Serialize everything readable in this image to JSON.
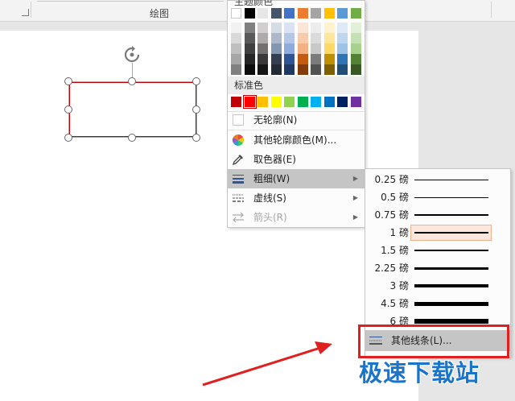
{
  "ribbon": {
    "group_label": "绘图"
  },
  "outline_menu": {
    "theme_colors_title": "主题颜色",
    "standard_colors_label": "标准色",
    "no_outline": "无轮廓(N)",
    "more_outline_colors": "其他轮廓颜色(M)...",
    "eyedropper": "取色器(E)",
    "weight": "粗细(W)",
    "dashes": "虚线(S)",
    "arrows": "箭头(R)",
    "theme_top_colors": [
      "#ffffff",
      "#000000",
      "#e7e6e6",
      "#44546a",
      "#4472c4",
      "#ed7d31",
      "#a5a5a5",
      "#ffc000",
      "#5b9bd5",
      "#70ad47"
    ],
    "standard_colors": [
      "#c00000",
      "#ff0000",
      "#ffc000",
      "#ffff00",
      "#92d050",
      "#00b050",
      "#00b0f0",
      "#0070c0",
      "#002060",
      "#7030a0"
    ],
    "selected_standard_color": "#ff0000"
  },
  "weight_submenu": {
    "items": [
      {
        "label": "0.25 磅"
      },
      {
        "label": "0.5 磅"
      },
      {
        "label": "0.75 磅"
      },
      {
        "label": "1 磅",
        "selected": true
      },
      {
        "label": "1.5 磅"
      },
      {
        "label": "2.25 磅"
      },
      {
        "label": "3 磅"
      },
      {
        "label": "4.5 磅"
      },
      {
        "label": "6 磅"
      }
    ],
    "more_lines": "其他线条(L)..."
  },
  "watermark": "极速下载站",
  "colors": {
    "shape_outline": "#c00000",
    "annotation_red": "#e02020",
    "watermark_blue": "#1a74c9"
  }
}
